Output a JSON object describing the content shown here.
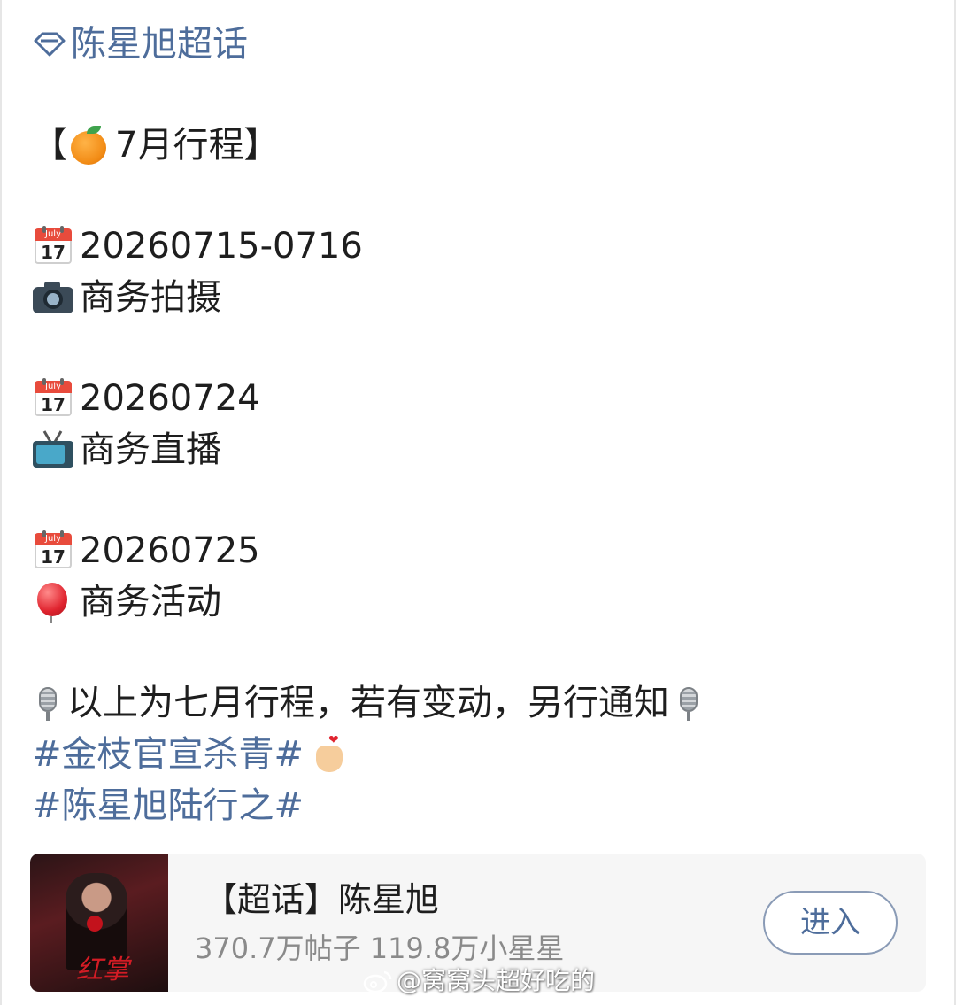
{
  "post": {
    "super_topic_link": "陈星旭超话",
    "schedule_title": "7月行程】",
    "schedule_title_open": "【",
    "entries": [
      {
        "date": "20260715-0716",
        "calendar_month": "July",
        "calendar_day": "17",
        "activity": "商务拍摄"
      },
      {
        "date": "20260724",
        "calendar_month": "July",
        "calendar_day": "17",
        "activity": "商务直播"
      },
      {
        "date": "20260725",
        "calendar_month": "July",
        "calendar_day": "17",
        "activity": "商务活动"
      }
    ],
    "notice": "以上为七月行程，若有变动，另行通知",
    "hashtags": [
      "#金枝官宣杀青#",
      "#陈星旭陆行之#"
    ],
    "icons": {
      "super_topic": "diamond-icon",
      "title": "orange-icon",
      "calendar": "calendar-icon",
      "activity_1": "camera-icon",
      "activity_2": "tv-icon",
      "activity_3": "balloon-icon",
      "notice": "microphone-icon",
      "hashtag_1": "finger-heart-icon"
    }
  },
  "card": {
    "title": "【超话】陈星旭",
    "stats": "370.7万帖子 119.8万小星星",
    "thumbnail_text": "红掌",
    "enter_label": "进入"
  },
  "watermark": {
    "text": "@窝窝头超好吃的"
  },
  "colors": {
    "link": "#4e6d9b",
    "text": "#1e1e1e",
    "muted": "#8a8a8a",
    "card_bg": "#f6f6f6"
  }
}
